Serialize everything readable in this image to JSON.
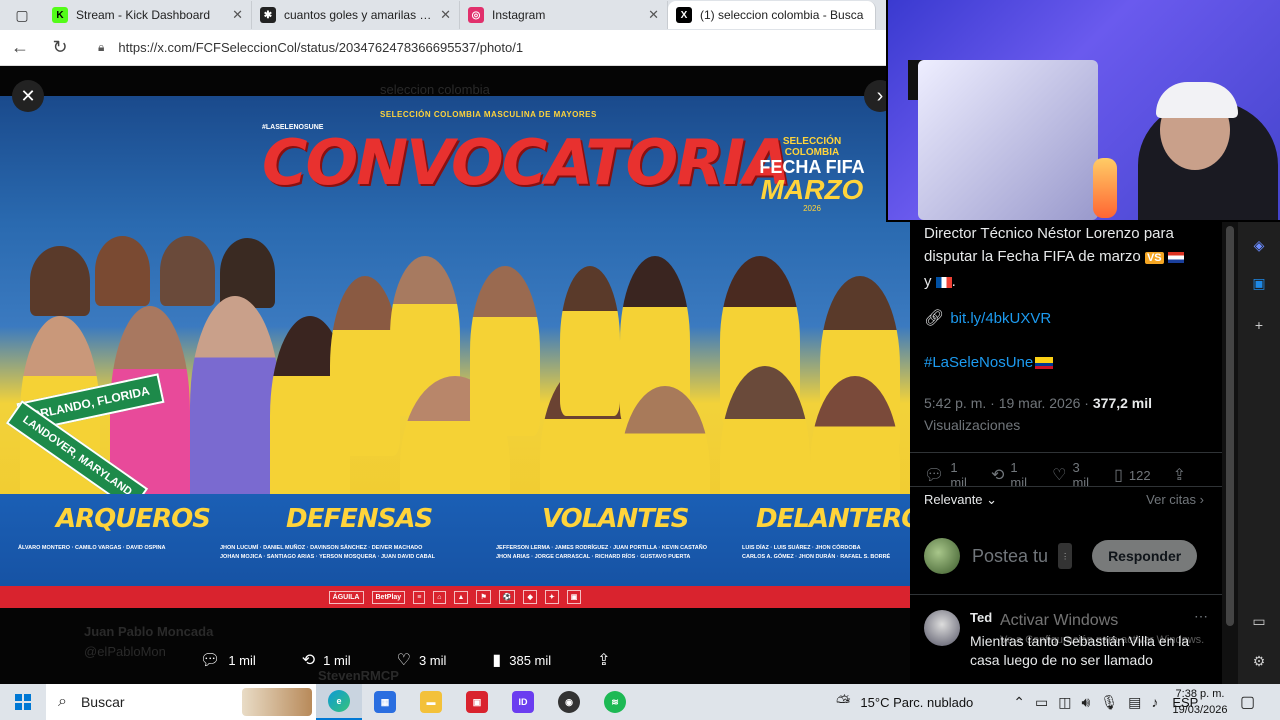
{
  "browser": {
    "tabs": [
      {
        "title": "Stream - Kick Dashboard",
        "icon": "kick-icon",
        "color": "#53fc18",
        "glyph": "K"
      },
      {
        "title": "cuantos goles y amarilas tiene",
        "icon": "ai-icon",
        "color": "#222222",
        "glyph": "✱"
      },
      {
        "title": "Instagram",
        "icon": "instagram-icon",
        "color": "#e1306c",
        "glyph": "◎"
      },
      {
        "title": "(1) seleccion colombia - Busca",
        "icon": "x-icon",
        "color": "#000000",
        "glyph": "X"
      }
    ],
    "url": "https://x.com/FCFSeleccionCol/status/2034762478366695537/photo/1"
  },
  "viewer": {
    "ghost_search": "seleccion colombia",
    "ghost_user": "Juan Pablo Moncada",
    "ghost_handle": "@elPabloMon",
    "ghost_user2": "StevenRMCP",
    "poster": {
      "top_label": "SELECCIÓN COLOMBIA MASCULINA DE MAYORES",
      "hashtag": "#LASELENOSUNE",
      "title": "CONVOCATORIA",
      "badge_l1": "SELECCIÓN COLOMBIA",
      "badge_l2": "FECHA FIFA",
      "badge_l3": "MARZO",
      "badge_l4": "2026",
      "sign1": "ORLANDO, FLORIDA",
      "sign2": "LANDOVER, MARYLAND",
      "positions": [
        {
          "label": "ARQUEROS",
          "names": [
            "ÁLVARO MONTERO",
            "CAMILO VARGAS",
            "DAVID OSPINA"
          ]
        },
        {
          "label": "DEFENSAS",
          "names": [
            "JHON LUCUMÍ",
            "DANIEL MUÑOZ",
            "DAVINSON SÁNCHEZ",
            "DEIVER MACHADO",
            "JOHAN MOJICA",
            "SANTIAGO ARIAS",
            "YERSON MOSQUERA",
            "JUAN DAVID CABAL"
          ]
        },
        {
          "label": "VOLANTES",
          "names": [
            "JEFFERSON LERMA",
            "JAMES RODRÍGUEZ",
            "JUAN PORTILLA",
            "KEVIN CASTAÑO",
            "JHON ARIAS",
            "JORGE CARRASCAL",
            "RICHARD RÍOS",
            "GUSTAVO PUERTA"
          ]
        },
        {
          "label": "DELANTEROS",
          "names": [
            "LUIS DÍAZ",
            "LUIS SUÁREZ",
            "JHON CÓRDOBA",
            "CARLOS A. GÓMEZ",
            "JHON DURÁN",
            "RAFAEL S. BORRÉ"
          ]
        }
      ],
      "sponsors": [
        "ÁGUILA",
        "BetPlay",
        "≡",
        "⌂",
        "▲",
        "⚑",
        "⚽",
        "◆",
        "✦",
        "▣"
      ]
    },
    "actions": {
      "replies": "1 mil",
      "reposts": "1 mil",
      "likes": "3 mil",
      "views": "385 mil"
    }
  },
  "tweet": {
    "text_line1": "Director Técnico Néstor Lorenzo para",
    "text_line2": "disputar la Fecha FIFA de marzo",
    "vs": "VS",
    "text_line3": "y",
    "link": "bit.ly/4bkUXVR",
    "hashtag": "#LaSeleNosUne",
    "time": "5:42 p. m. · 19 mar. 2026 · ",
    "views_count": "377,2 mil",
    "views_label": "Visualizaciones",
    "stats": {
      "replies": "1 mil",
      "reposts": "1 mil",
      "likes": "3 mil",
      "bookmarks": "122"
    },
    "sort": "Relevante",
    "quotes": "Ver citas",
    "reply_placeholder": "Postea tu",
    "reply_button": "Responder"
  },
  "comment": {
    "author": "Ted",
    "text": "Mientras tanto Sebastián Villa en la casa luego de no ser llamado"
  },
  "windows_watermark": {
    "line1": "Activar Windows",
    "line2": "Ve a Configuración para activar Windows."
  },
  "taskbar": {
    "search": "Buscar",
    "weather": "15°C  Parc. nublado",
    "lang": "ESP",
    "time": "7:38 p. m.",
    "date": "19/03/2026"
  },
  "colors": {
    "x_blue": "#1d9bf0",
    "muted": "#71767b",
    "poster_red": "#e8312f",
    "poster_yellow": "#ffd43b"
  }
}
